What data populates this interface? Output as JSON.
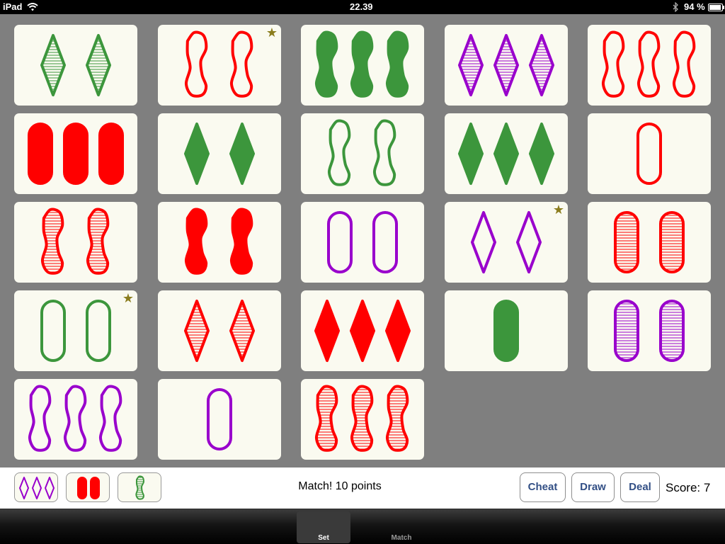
{
  "statusbar": {
    "device": "iPad",
    "time": "22.39",
    "battery": "94 %"
  },
  "colors": {
    "red": "#ff0000",
    "green": "#3c963c",
    "purple": "#9900cc",
    "star": "#8b7d1e"
  },
  "board": {
    "cards": [
      {
        "count": 2,
        "color": "green",
        "shape": "diamond",
        "fill": "striped",
        "star": false
      },
      {
        "count": 2,
        "color": "red",
        "shape": "squiggle",
        "fill": "open",
        "star": true
      },
      {
        "count": 3,
        "color": "green",
        "shape": "squiggle",
        "fill": "solid",
        "star": false
      },
      {
        "count": 3,
        "color": "purple",
        "shape": "diamond",
        "fill": "striped",
        "star": false
      },
      {
        "count": 3,
        "color": "red",
        "shape": "squiggle",
        "fill": "open",
        "star": false
      },
      {
        "count": 3,
        "color": "red",
        "shape": "oval",
        "fill": "solid",
        "star": false
      },
      {
        "count": 2,
        "color": "green",
        "shape": "diamond",
        "fill": "solid",
        "star": false
      },
      {
        "count": 2,
        "color": "green",
        "shape": "squiggle",
        "fill": "open",
        "star": false
      },
      {
        "count": 3,
        "color": "green",
        "shape": "diamond",
        "fill": "solid",
        "star": false
      },
      {
        "count": 1,
        "color": "red",
        "shape": "oval",
        "fill": "open",
        "star": false
      },
      {
        "count": 2,
        "color": "red",
        "shape": "squiggle",
        "fill": "striped",
        "star": false
      },
      {
        "count": 2,
        "color": "red",
        "shape": "squiggle",
        "fill": "solid",
        "star": false
      },
      {
        "count": 2,
        "color": "purple",
        "shape": "oval",
        "fill": "open",
        "star": false
      },
      {
        "count": 2,
        "color": "purple",
        "shape": "diamond",
        "fill": "open",
        "star": true
      },
      {
        "count": 2,
        "color": "red",
        "shape": "oval",
        "fill": "striped",
        "star": false
      },
      {
        "count": 2,
        "color": "green",
        "shape": "oval",
        "fill": "open",
        "star": true
      },
      {
        "count": 2,
        "color": "red",
        "shape": "diamond",
        "fill": "striped",
        "star": false
      },
      {
        "count": 3,
        "color": "red",
        "shape": "diamond",
        "fill": "solid",
        "star": false
      },
      {
        "count": 1,
        "color": "green",
        "shape": "oval",
        "fill": "solid",
        "star": false
      },
      {
        "count": 2,
        "color": "purple",
        "shape": "oval",
        "fill": "striped",
        "star": false
      },
      {
        "count": 3,
        "color": "purple",
        "shape": "squiggle",
        "fill": "open",
        "star": false
      },
      {
        "count": 1,
        "color": "purple",
        "shape": "oval",
        "fill": "open",
        "star": false
      },
      {
        "count": 3,
        "color": "red",
        "shape": "squiggle",
        "fill": "striped",
        "star": false
      }
    ]
  },
  "found_set": [
    {
      "count": 3,
      "color": "purple",
      "shape": "diamond",
      "fill": "open"
    },
    {
      "count": 2,
      "color": "red",
      "shape": "oval",
      "fill": "solid"
    },
    {
      "count": 1,
      "color": "green",
      "shape": "squiggle",
      "fill": "striped"
    }
  ],
  "message": "Match! 10 points",
  "buttons": {
    "cheat": "Cheat",
    "draw": "Draw",
    "deal": "Deal"
  },
  "score": "Score: 7",
  "tabs": [
    {
      "label": "Set",
      "active": true
    },
    {
      "label": "Match",
      "active": false
    }
  ]
}
